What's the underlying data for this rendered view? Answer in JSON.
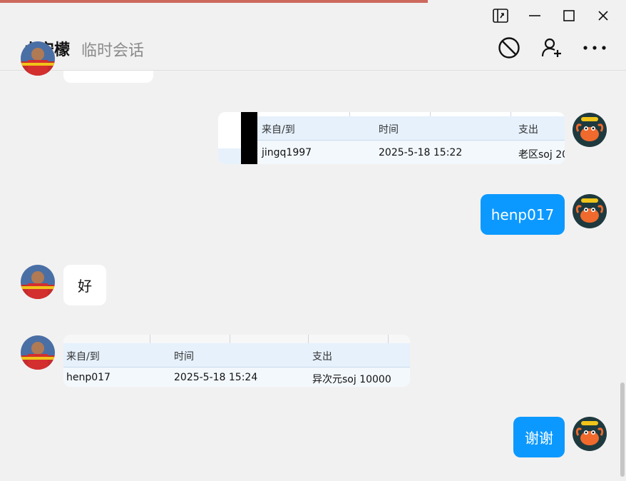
{
  "window": {
    "controls": [
      {
        "name": "pin-window-icon"
      },
      {
        "name": "minimize-icon"
      },
      {
        "name": "maximize-icon"
      },
      {
        "name": "close-icon"
      }
    ]
  },
  "header": {
    "title": "小安檬",
    "subtitle": "临时会话",
    "actions": [
      "block-icon",
      "add-friend-icon",
      "more-icon"
    ]
  },
  "messages": [
    {
      "side": "left",
      "type": "text",
      "text": ""
    },
    {
      "side": "right",
      "type": "table-image",
      "columns": [
        "来自/到",
        "时间",
        "支出"
      ],
      "row": [
        "jingq1997",
        "2025-5-18 15:22",
        "老区soj 20"
      ]
    },
    {
      "side": "right",
      "type": "text",
      "text": "henp017"
    },
    {
      "side": "left",
      "type": "text",
      "text": "好"
    },
    {
      "side": "left",
      "type": "table-image",
      "columns": [
        "来自/到",
        "时间",
        "支出"
      ],
      "row": [
        "henp017",
        "2025-5-18 15:24",
        "异次元soj 10000"
      ]
    },
    {
      "side": "right",
      "type": "text",
      "text": "谢谢"
    }
  ],
  "colors": {
    "background": "#f2f1f1",
    "self_bubble": "#0c99ff",
    "other_bubble": "#ffffff",
    "table_header": "#e6f1fc",
    "table_row": "#f3f8fd"
  }
}
